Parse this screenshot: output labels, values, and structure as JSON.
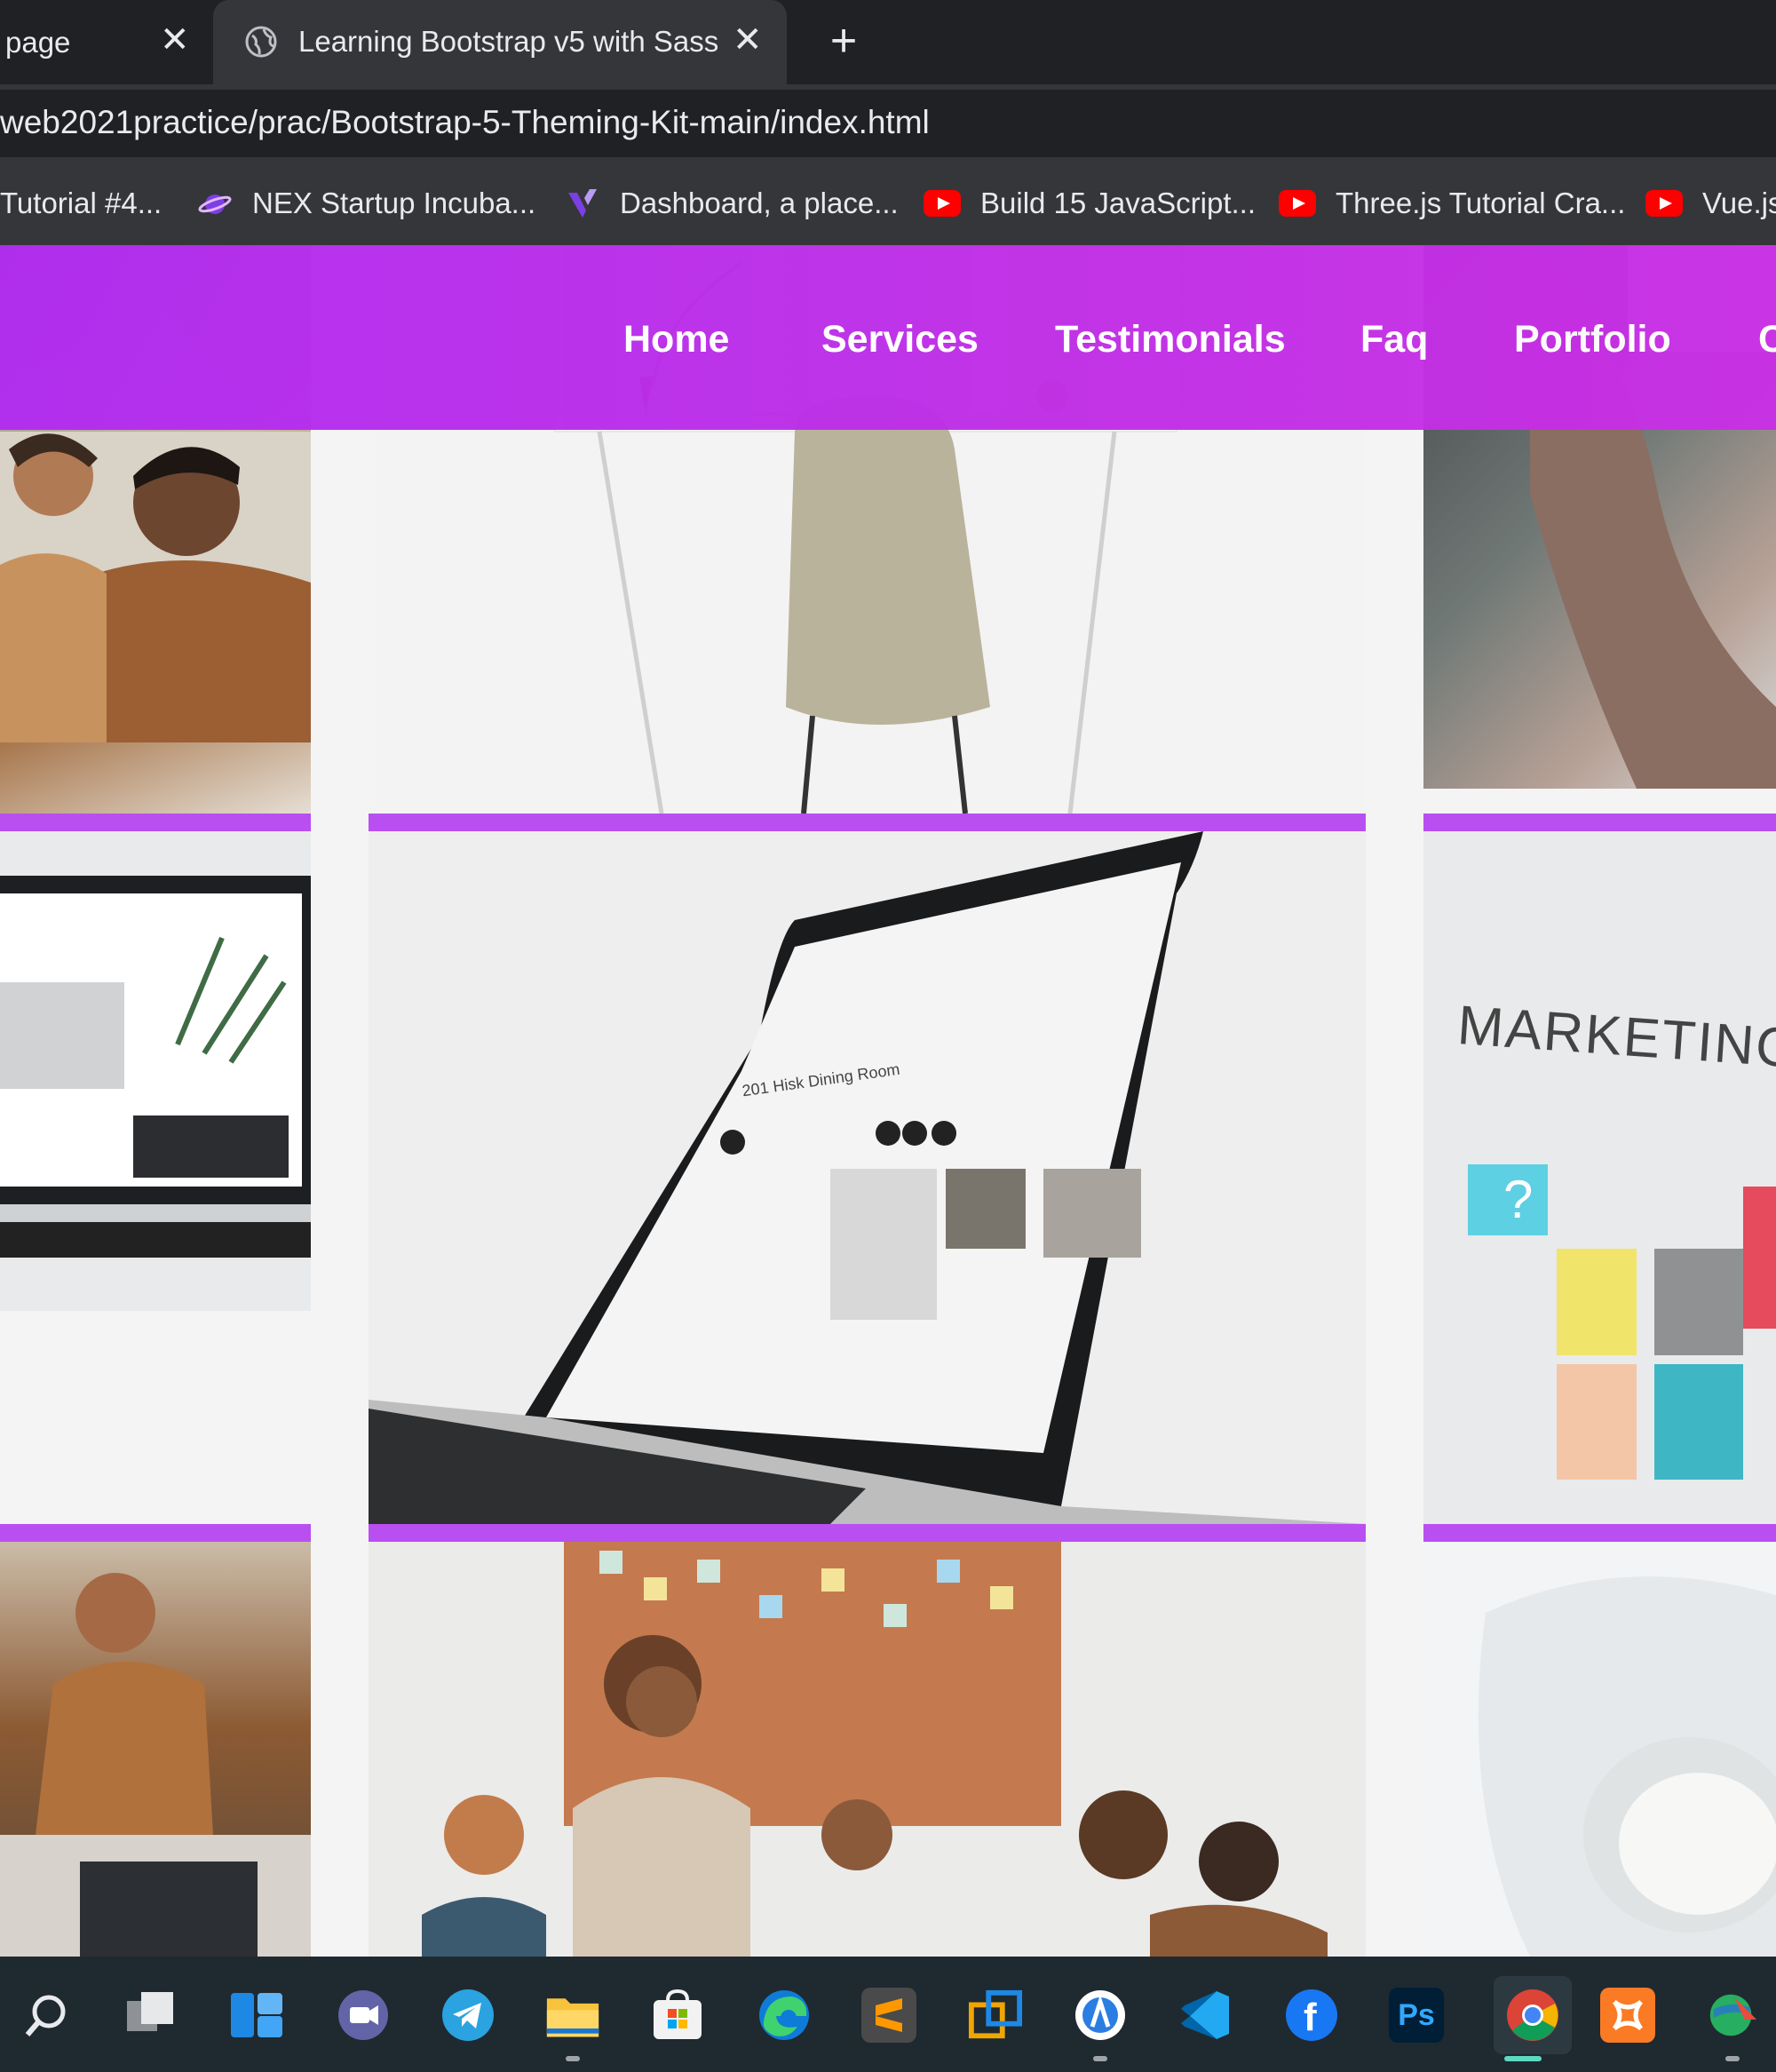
{
  "browser": {
    "tabs": [
      {
        "title": "page",
        "active": false
      },
      {
        "title": "Learning Bootstrap v5 with Sass",
        "active": true
      }
    ],
    "new_tab": "+",
    "close_glyph": "✕",
    "address": "web2021practice/prac/Bootstrap-5-Theming-Kit-main/index.html",
    "bookmarks": [
      {
        "label": "Tutorial #4...",
        "icon": "none"
      },
      {
        "label": "NEX Startup Incuba...",
        "icon": "planet-icon"
      },
      {
        "label": "Dashboard, a place...",
        "icon": "vuetify-icon"
      },
      {
        "label": "Build 15 JavaScript...",
        "icon": "youtube-icon"
      },
      {
        "label": "Three.js Tutorial Cra...",
        "icon": "youtube-icon"
      },
      {
        "label": "Vue.js",
        "icon": "youtube-icon"
      }
    ]
  },
  "site": {
    "nav": [
      "Home",
      "Services",
      "Testimonials",
      "Faq",
      "Portfolio",
      "C"
    ],
    "colors": {
      "navbar": "#c02ee6",
      "accent_bar": "#b94ff0"
    },
    "gallery": {
      "marketing_text": "MARKETING ST",
      "laptop_screen_text": "201 Hisk Dining Room"
    }
  },
  "taskbar": {
    "icons": [
      "search-icon",
      "task-view-icon",
      "widgets-icon",
      "teams-chat-icon",
      "telegram-icon",
      "file-explorer-icon",
      "microsoft-store-icon",
      "edge-icon",
      "sublime-text-icon",
      "virtualbox-icon",
      "android-studio-icon",
      "vscode-icon",
      "facebook-icon",
      "photoshop-icon",
      "chrome-icon",
      "xampp-icon",
      "network-globe-icon"
    ],
    "labels": {
      "photoshop": "Ps",
      "facebook": "f",
      "sublime": "S"
    }
  }
}
